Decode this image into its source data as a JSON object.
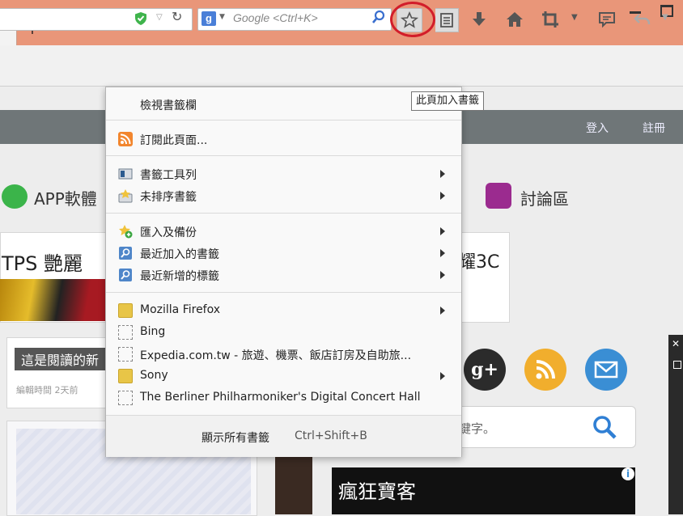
{
  "window": {
    "new_tab": "+"
  },
  "toolbar": {
    "search_placeholder": "Google <Ctrl+K>",
    "search_engine_letter": "g",
    "bookmark_tooltip": "此頁加入書籤"
  },
  "site": {
    "nav": {
      "login": "登入",
      "register": "註冊"
    },
    "categories": [
      {
        "label": "APP軟體"
      },
      {
        "label": "討論區"
      }
    ],
    "card1": {
      "title": "TPS 艷麗",
      "right_title": "耀3C"
    },
    "card2": {
      "title": "這是閱讀的新",
      "meta": "編輯時間 2天前"
    },
    "social_gplus": "g+",
    "search_placeholder": "鍵字。",
    "ad_text": "瘋狂寶客",
    "ad_info": "i"
  },
  "bookmarks_menu": {
    "view_sidebar": "檢視書籤欄",
    "subscribe": "訂閱此頁面...",
    "toolbar": "書籤工具列",
    "unsorted": "未排序書籤",
    "import_backup": "匯入及備份",
    "recently_bookmarked": "最近加入的書籤",
    "recent_tags": "最近新增的標籤",
    "items": [
      {
        "label": "Mozilla Firefox",
        "kind": "folder",
        "submenu": true
      },
      {
        "label": "Bing",
        "kind": "page",
        "submenu": false
      },
      {
        "label": "Expedia.com.tw - 旅遊、機票、飯店訂房及自助旅...",
        "kind": "page",
        "submenu": false
      },
      {
        "label": "Sony",
        "kind": "folder",
        "submenu": true
      },
      {
        "label": "The Berliner Philharmoniker's Digital Concert Hall",
        "kind": "page",
        "submenu": false
      }
    ],
    "show_all": "顯示所有書籤",
    "show_all_shortcut": "Ctrl+Shift+B"
  },
  "colors": {
    "titlebar": "#e99679",
    "highlight_circle": "#d21d2a",
    "site_nav": "#6f7678"
  }
}
